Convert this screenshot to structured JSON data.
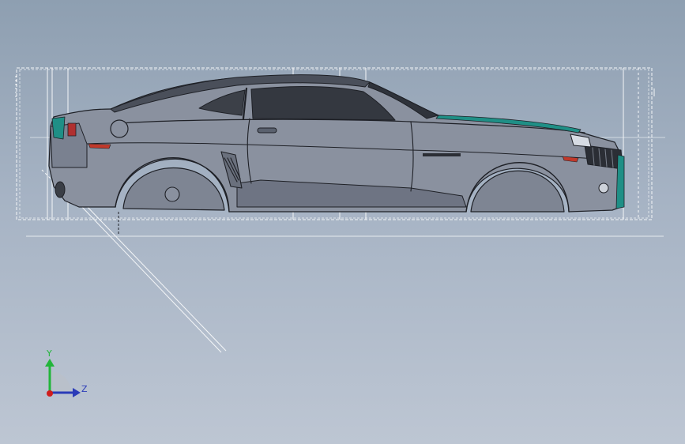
{
  "viewport": {
    "background_top": "#8e9fb1",
    "background_bottom": "#bdc6d3",
    "model": "sports-coupe-side-view"
  },
  "triad": {
    "y_label": "Y",
    "z_label": "Z",
    "y_color": "#22b53a",
    "z_color": "#2a3bb8",
    "x_color": "#d01c1c"
  },
  "colors": {
    "body_fill": "#8a919f",
    "body_dark": "#5a616e",
    "edge": "#1e2026",
    "accent": "#1f8f86",
    "taillight": "#c0392b",
    "sketch_line": "#f4f6f8"
  }
}
